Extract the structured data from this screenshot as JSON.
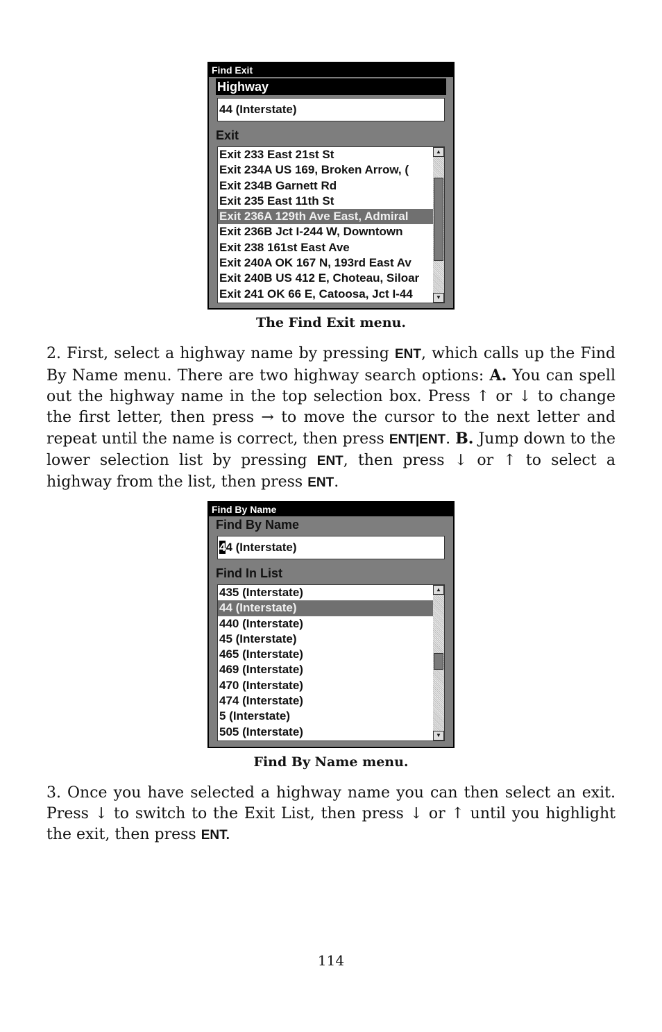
{
  "screen1": {
    "title": "Find Exit",
    "highway_label": "Highway",
    "highway_value": "44 (Interstate)",
    "exit_label": "Exit",
    "exits": [
      "Exit 233 East 21st St",
      "Exit 234A US 169, Broken Arrow, (",
      "Exit 234B Garnett Rd",
      "Exit 235 East 11th St",
      "Exit 236A 129th Ave East, Admiral",
      "Exit 236B Jct I-244 W, Downtown",
      "Exit 238 161st East Ave",
      "Exit 240A OK 167 N, 193rd East Av",
      "Exit 240B US 412 E, Choteau, Siloar",
      "Exit 241 OK 66 E, Catoosa, Jct I-44"
    ],
    "selected_index": 4,
    "caption": "The Find Exit menu."
  },
  "para2": {
    "p1": "2. First, select a highway name by pressing ",
    "k1": "ENT",
    "p2": ", which calls up the Find By Name menu. There are two highway search options: ",
    "a": "A.",
    "p3": " You can spell out the highway name in the top selection box. Press ↑ or ↓ to change the first letter, then press → to move the cursor to the next letter and repeat until the name is correct, then press ",
    "k2": "ENT|ENT",
    "p4": ". ",
    "b": "B.",
    "p5": " Jump down to the lower selection list by pressing ",
    "k3": "ENT",
    "p6": ", then press ↓ or ↑ to select a highway from the list, then press ",
    "k4": "ENT",
    "p7": "."
  },
  "screen2": {
    "title": "Find By Name",
    "name_label": "Find By Name",
    "name_cursor_char": "4",
    "name_rest": "4 (Interstate)",
    "list_label": "Find In List",
    "items": [
      "435 (Interstate)",
      "44 (Interstate)",
      "440 (Interstate)",
      "45 (Interstate)",
      "465 (Interstate)",
      "469 (Interstate)",
      "470 (Interstate)",
      "474 (Interstate)",
      "5 (Interstate)",
      "505 (Interstate)"
    ],
    "selected_index": 1,
    "caption": "Find By Name menu."
  },
  "para3": {
    "text": "3. Once you have selected a highway name you can then select an exit. Press ↓ to switch to the Exit List, then press ↓ or ↑ until you highlight the exit, then press ",
    "key": "ENT."
  },
  "page_number": "114"
}
